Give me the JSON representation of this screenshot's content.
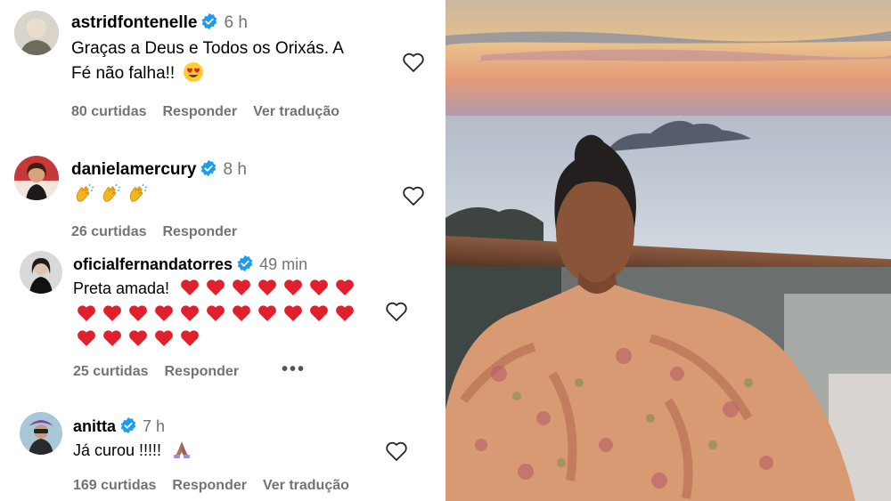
{
  "comments": [
    {
      "username": "astridfontenelle",
      "time": "6 h",
      "text_line1": "Graças a Deus e Todos os Orixás. A",
      "text_line2": "Fé não falha!!",
      "likes": "80 curtidas",
      "reply": "Responder",
      "translate": "Ver tradução",
      "emoji": "smiling-face-with-heart-eyes"
    },
    {
      "username": "danielamercury",
      "time": "8 h",
      "likes": "26 curtidas",
      "reply": "Responder",
      "emoji": "clapping-hands"
    },
    {
      "username": "oficialfernandatorres",
      "time": "49 min",
      "text": "Preta amada!",
      "likes": "25 curtidas",
      "reply": "Responder",
      "more": "•••",
      "emoji": "red-heart"
    },
    {
      "username": "anitta",
      "time": "7 h",
      "text": "Já curou !!!!!",
      "likes": "169 curtidas",
      "reply": "Responder",
      "translate": "Ver tradução",
      "emoji": "folded-hands"
    }
  ],
  "colors": {
    "verified": "#1d9bf0",
    "meta": "#737373",
    "heart_red": "#e0202c"
  }
}
